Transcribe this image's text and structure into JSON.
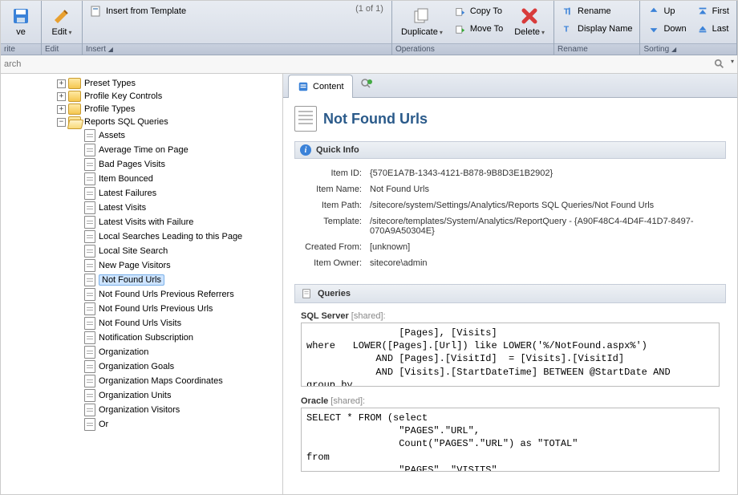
{
  "ribbon": {
    "save_group": {
      "save": "ve",
      "edit": "Edit",
      "label": "rite",
      "label2": "Edit"
    },
    "insert_group": {
      "template": "Insert from Template",
      "count": "(1 of 1)",
      "label": "Insert"
    },
    "operations": {
      "duplicate": "Duplicate",
      "copyto": "Copy To",
      "moveto": "Move To",
      "delete": "Delete",
      "label": "Operations"
    },
    "rename": {
      "rename": "Rename",
      "display": "Display Name",
      "label": "Rename"
    },
    "sorting": {
      "up": "Up",
      "down": "Down",
      "first": "First",
      "last": "Last",
      "label": "Sorting"
    }
  },
  "search": {
    "placeholder": "arch"
  },
  "tree": {
    "parents": [
      {
        "label": "Preset Types"
      },
      {
        "label": "Profile Key Controls"
      },
      {
        "label": "Profile Types"
      },
      {
        "label": "Reports SQL Queries"
      }
    ],
    "children": [
      "Assets",
      "Average Time on Page",
      "Bad Pages Visits",
      "Item Bounced",
      "Latest Failures",
      "Latest Visits",
      "Latest Visits with Failure",
      "Local Searches Leading to this Page",
      "Local Site Search",
      "New Page Visitors",
      "Not Found Urls",
      "Not Found Urls Previous Referrers",
      "Not Found Urls Previous Urls",
      "Not Found Urls Visits",
      "Notification Subscription",
      "Organization",
      "Organization Goals",
      "Organization Maps Coordinates",
      "Organization Units",
      "Organization Visitors",
      "Or"
    ],
    "selected_index": 10
  },
  "tabs": {
    "content": "Content"
  },
  "page": {
    "title": "Not Found Urls"
  },
  "quickinfo": {
    "header": "Quick Info",
    "rows": [
      {
        "label": "Item ID:",
        "value": "{570E1A7B-1343-4121-B878-9B8D3E1B2902}"
      },
      {
        "label": "Item Name:",
        "value": "Not Found Urls"
      },
      {
        "label": "Item Path:",
        "value": "/sitecore/system/Settings/Analytics/Reports SQL Queries/Not Found Urls"
      },
      {
        "label": "Template:",
        "value": "/sitecore/templates/System/Analytics/ReportQuery - {A90F48C4-4D4F-41D7-8497-070A9A50304E}"
      },
      {
        "label": "Created From:",
        "value": "[unknown]"
      },
      {
        "label": "Item Owner:",
        "value": "sitecore\\admin"
      }
    ]
  },
  "queries": {
    "header": "Queries",
    "sqlserver_label": "SQL Server",
    "shared": " [shared]:",
    "sqlserver_text": "                [Pages], [Visits]\nwhere   LOWER([Pages].[Url]) like LOWER('%/NotFound.aspx%')\n            AND [Pages].[VisitId]  = [Visits].[VisitId]\n            AND [Visits].[StartDateTime] BETWEEN @StartDate AND \ngroup by",
    "oracle_label": "Oracle",
    "oracle_text": "SELECT * FROM (select\n                \"PAGES\".\"URL\",\n                Count(\"PAGES\".\"URL\") as \"TOTAL\"\nfrom\n                \"PAGES\", \"VISITS\""
  }
}
